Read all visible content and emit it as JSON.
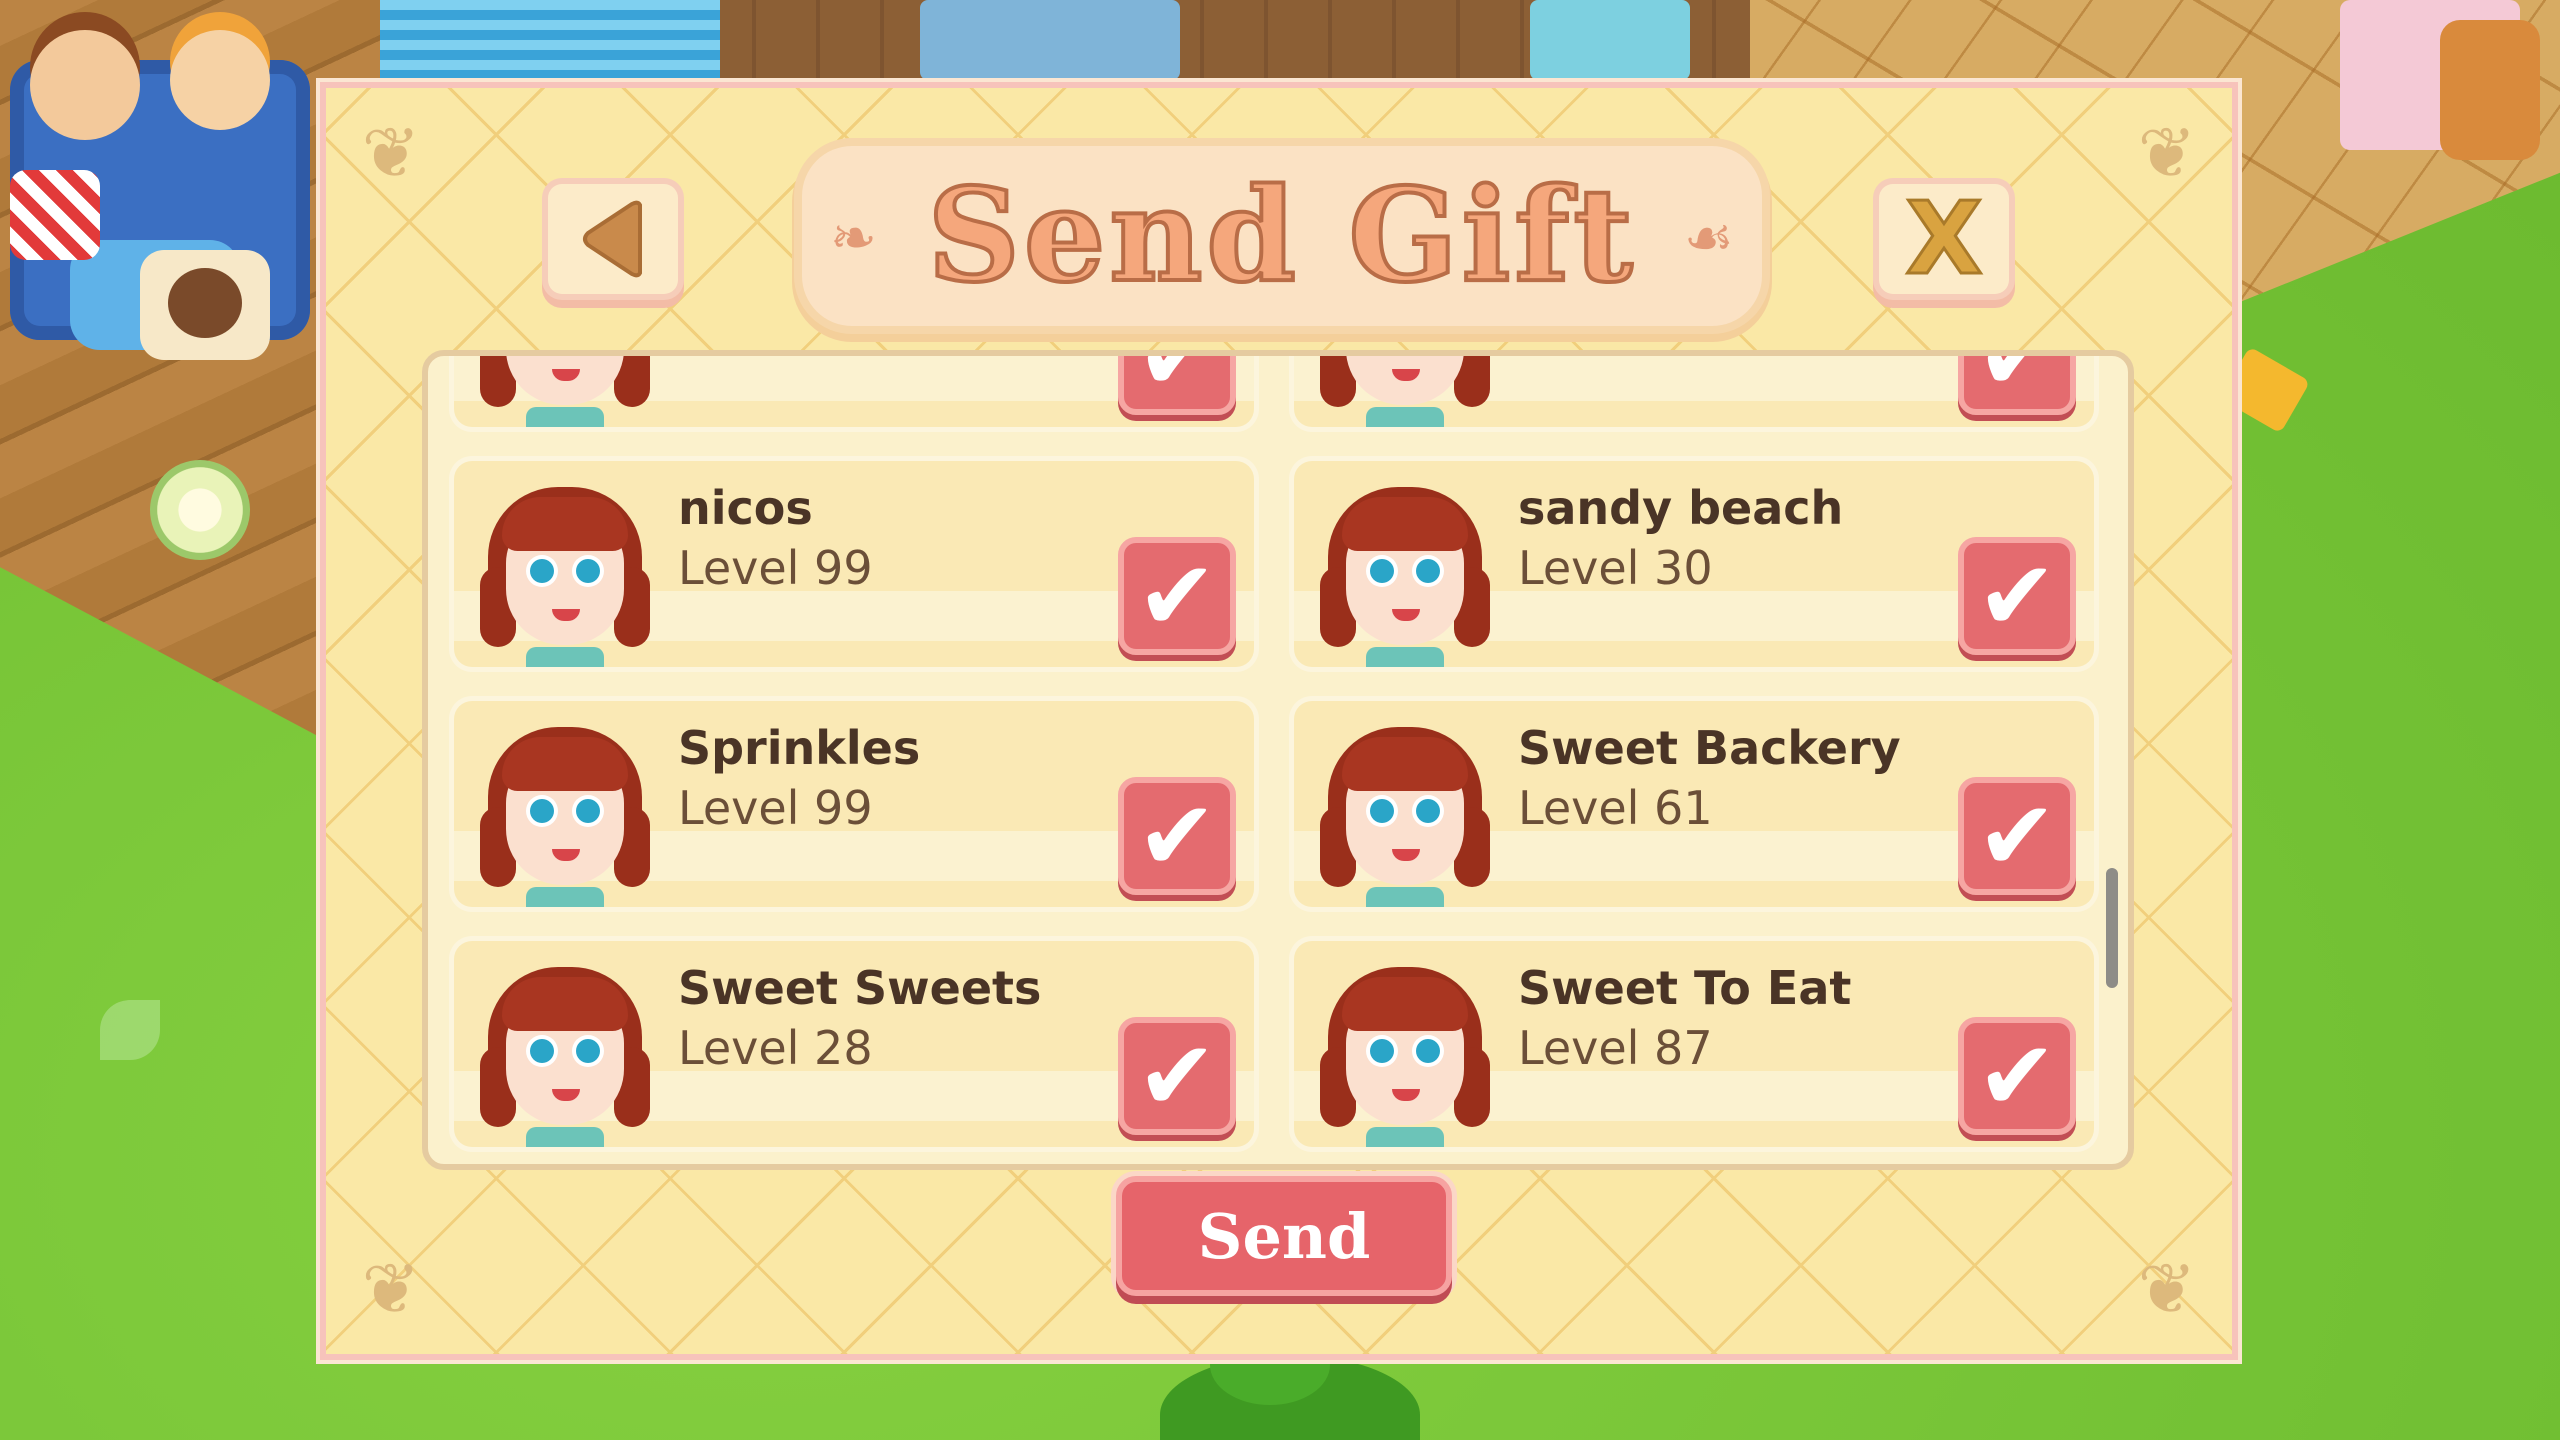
{
  "dialog": {
    "title": "Send Gift",
    "close_label": "X",
    "send_label": "Send"
  },
  "friends": [
    {
      "name": "",
      "level": ""
    },
    {
      "name": "",
      "level": ""
    },
    {
      "name": "nicos",
      "level": "Level 99",
      "selected": true
    },
    {
      "name": "sandy beach",
      "level": "Level 30",
      "selected": true
    },
    {
      "name": "Sprinkles",
      "level": "Level 99",
      "selected": true
    },
    {
      "name": "Sweet Backery",
      "level": "Level 61",
      "selected": true
    },
    {
      "name": "Sweet Sweets",
      "level": "Level 28",
      "selected": true
    },
    {
      "name": "Sweet To Eat",
      "level": "Level 87",
      "selected": true
    }
  ],
  "colors": {
    "panel": "#fae8a6",
    "panel_border": "#f7c3bb",
    "accent_red": "#e46b6f",
    "title_orange": "#f5a77c",
    "grass": "#74c235"
  }
}
